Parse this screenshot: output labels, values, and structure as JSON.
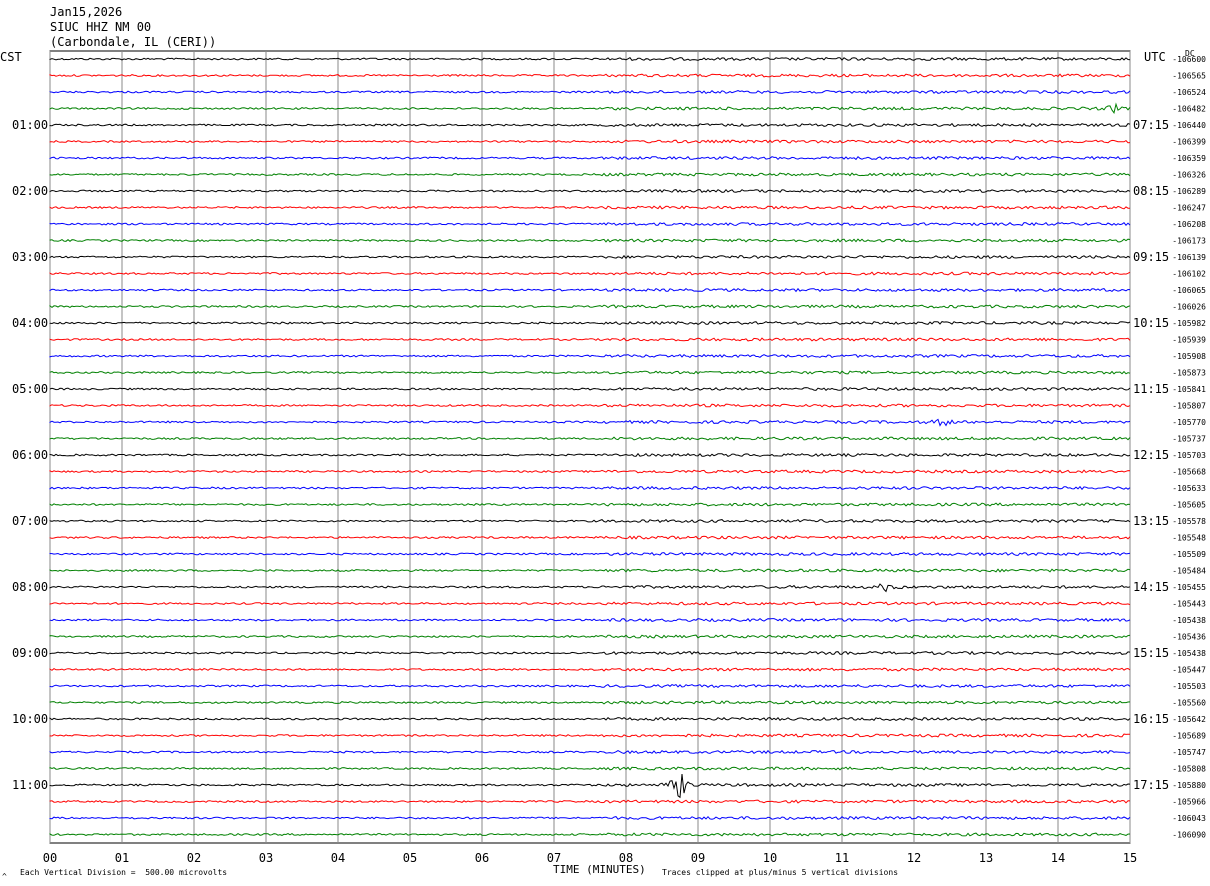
{
  "header": {
    "date": "Jan15,2026",
    "station": "SIUC HHZ NM 00",
    "location": "(Carbondale, IL (CERI))"
  },
  "left_axis_label": "CST",
  "right_axis_label": "UTC",
  "dc_label": "DC",
  "footer": {
    "scale_note": "Each Vertical Division =  500.00 microvolts",
    "clip_note": "Traces clipped at plus/minus 5 vertical divisions",
    "corner_mark": "^"
  },
  "chart_data": {
    "type": "line",
    "title": "",
    "xlabel": "TIME (MINUTES)",
    "ylabel": "",
    "xlim": [
      0,
      15
    ],
    "x_ticks": [
      "00",
      "01",
      "02",
      "03",
      "04",
      "05",
      "06",
      "07",
      "08",
      "09",
      "10",
      "11",
      "12",
      "13",
      "14",
      "15"
    ],
    "trace_colors": [
      "#000000",
      "#ff0000",
      "#0000ff",
      "#008000"
    ],
    "cst_labels": [
      {
        "row": 4,
        "label": "01:00"
      },
      {
        "row": 8,
        "label": "02:00"
      },
      {
        "row": 12,
        "label": "03:00"
      },
      {
        "row": 16,
        "label": "04:00"
      },
      {
        "row": 20,
        "label": "05:00"
      },
      {
        "row": 24,
        "label": "06:00"
      },
      {
        "row": 28,
        "label": "07:00"
      },
      {
        "row": 32,
        "label": "08:00"
      },
      {
        "row": 36,
        "label": "09:00"
      },
      {
        "row": 40,
        "label": "10:00"
      },
      {
        "row": 44,
        "label": "11:00"
      }
    ],
    "utc_labels": [
      {
        "row": 4,
        "label": "07:15"
      },
      {
        "row": 8,
        "label": "08:15"
      },
      {
        "row": 12,
        "label": "09:15"
      },
      {
        "row": 16,
        "label": "10:15"
      },
      {
        "row": 20,
        "label": "11:15"
      },
      {
        "row": 24,
        "label": "12:15"
      },
      {
        "row": 28,
        "label": "13:15"
      },
      {
        "row": 32,
        "label": "14:15"
      },
      {
        "row": 36,
        "label": "15:15"
      },
      {
        "row": 40,
        "label": "16:15"
      },
      {
        "row": 44,
        "label": "17:15"
      }
    ],
    "dc_offsets": [
      "-106600",
      "-106565",
      "-106524",
      "-106482",
      "-106440",
      "-106399",
      "-106359",
      "-106326",
      "-106289",
      "-106247",
      "-106208",
      "-106173",
      "-106139",
      "-106102",
      "-106065",
      "-106026",
      "-105982",
      "-105939",
      "-105908",
      "-105873",
      "-105841",
      "-105807",
      "-105770",
      "-105737",
      "-105703",
      "-105668",
      "-105633",
      "-105605",
      "-105578",
      "-105548",
      "-105509",
      "-105484",
      "-105455",
      "-105443",
      "-105438",
      "-105436",
      "-105438",
      "-105447",
      "-105503",
      "-105560",
      "-105642",
      "-105689",
      "-105747",
      "-105808",
      "-105880",
      "-105966",
      "-106043",
      "-106090"
    ],
    "events": [
      {
        "row": 44,
        "minute": 8.75,
        "description": "largest burst"
      },
      {
        "row": 32,
        "minute": 11.6
      },
      {
        "row": 22,
        "minute": 12.4
      },
      {
        "row": 3,
        "minute": 14.8
      }
    ]
  }
}
